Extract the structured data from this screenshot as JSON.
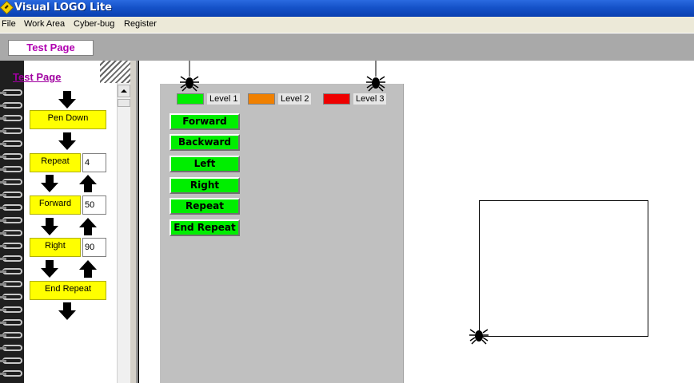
{
  "window": {
    "title": "Visual LOGO Lite"
  },
  "menu": [
    "File",
    "Work Area",
    "Cyber-bug",
    "Register"
  ],
  "tab": {
    "label": "Test Page"
  },
  "program": {
    "page_title": "Test Page",
    "blocks": [
      {
        "label": "Pen Down"
      },
      {
        "label": "Repeat",
        "value": "4"
      },
      {
        "label": "Forward",
        "value": "50"
      },
      {
        "label": "Right",
        "value": "90"
      },
      {
        "label": "End Repeat"
      }
    ]
  },
  "palette": {
    "levels": [
      {
        "label": "Level 1",
        "color": "#00ee00"
      },
      {
        "label": "Level 2",
        "color": "#f08000"
      },
      {
        "label": "Level 3",
        "color": "#ee0000"
      }
    ],
    "commands": [
      "Forward",
      "Backward",
      "Left",
      "Right",
      "Repeat",
      "End Repeat"
    ]
  },
  "icons": [
    "app-icon",
    "spider-icon",
    "arrow-down-icon",
    "arrow-up-icon",
    "scroll-up-icon"
  ]
}
